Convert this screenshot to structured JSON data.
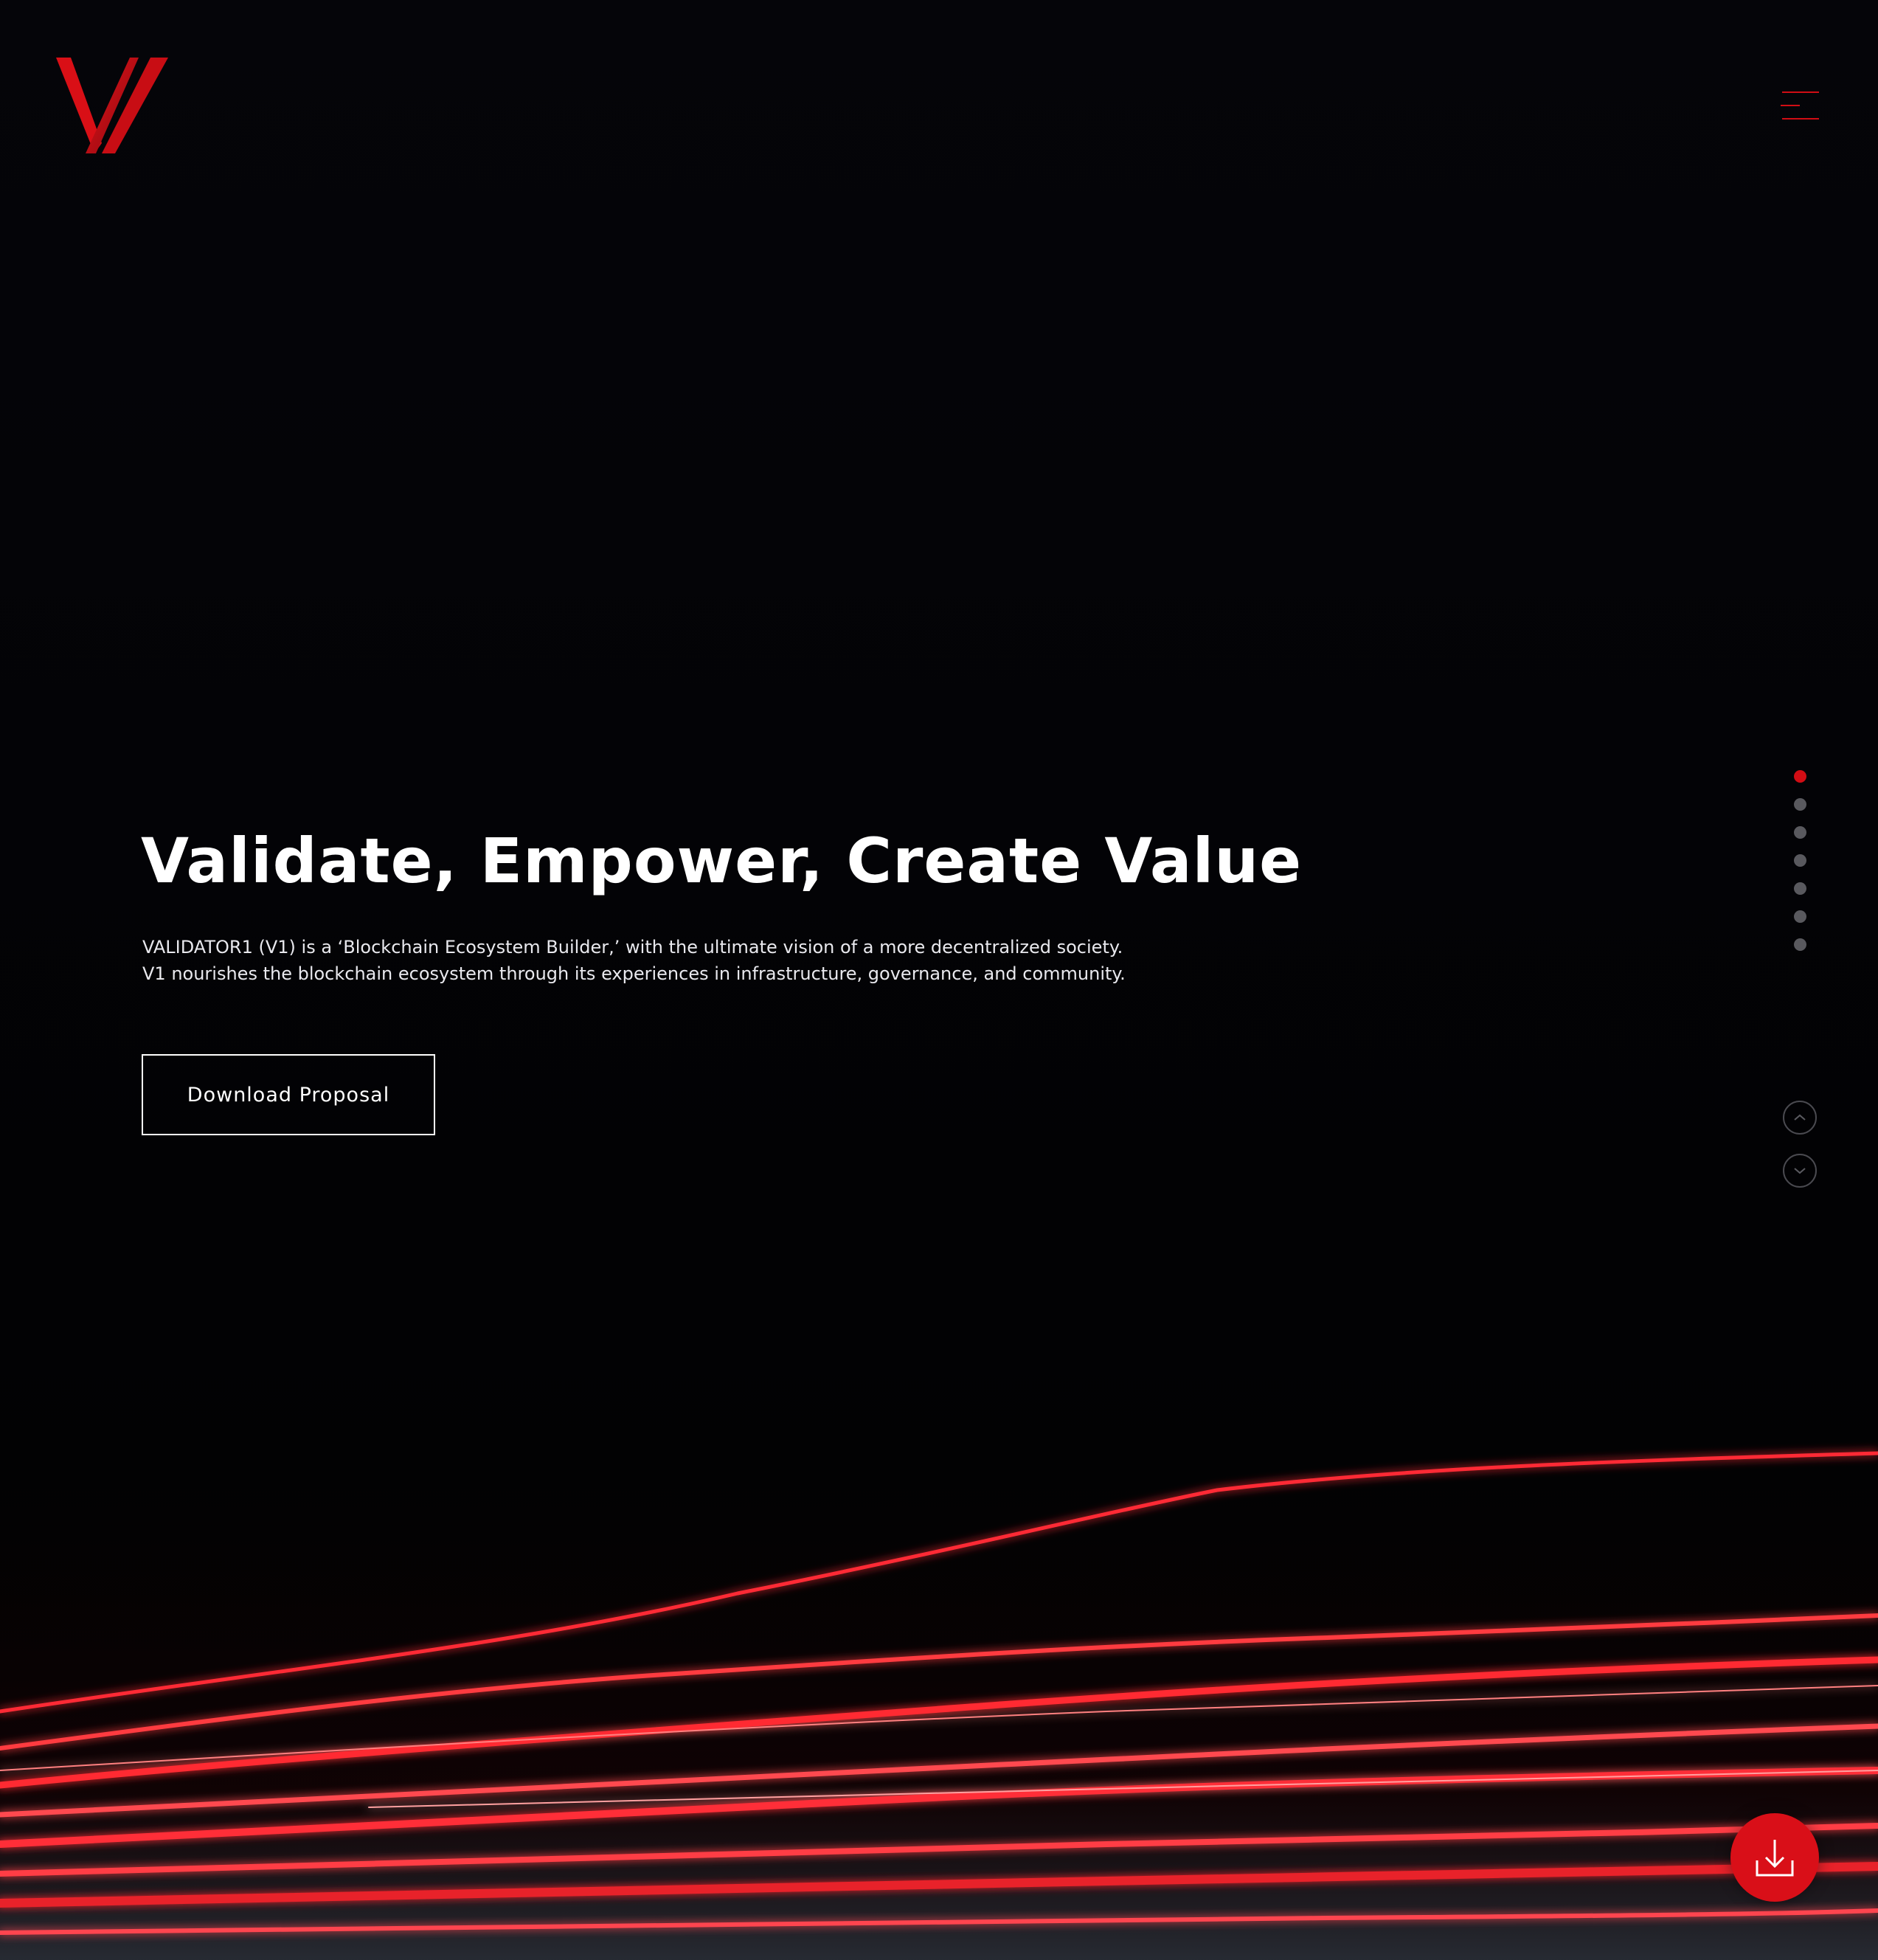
{
  "brand": {
    "logo_icon": "v-logo-icon",
    "accent_color": "#d10d14"
  },
  "header": {
    "menu_icon": "hamburger-menu-icon"
  },
  "hero": {
    "title": "Validate, Empower, Create Value",
    "description_line1": "VALIDATOR1 (V1) is a ‘Blockchain Ecosystem Builder,’ with the ultimate vision of a more decentralized society.",
    "description_line2": "V1 nourishes the blockchain ecosystem through its experiences in infrastructure, governance, and community.",
    "cta_label": "Download Proposal"
  },
  "section_nav": {
    "total_sections": 7,
    "active_index": 0,
    "up_icon": "chevron-up-icon",
    "down_icon": "chevron-down-icon"
  },
  "fab": {
    "icon": "download-icon",
    "color": "#d90f18"
  }
}
